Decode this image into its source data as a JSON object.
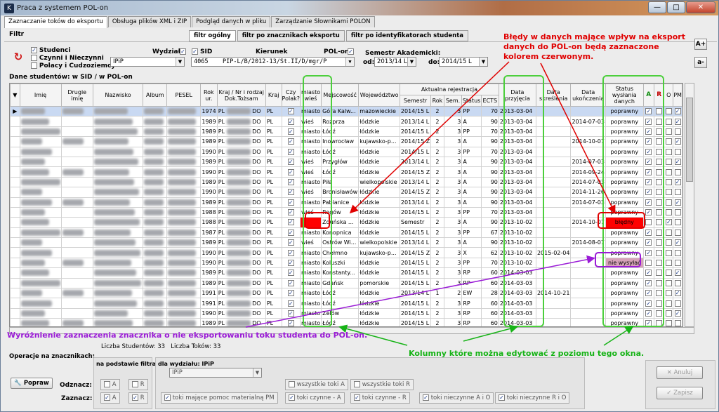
{
  "window": {
    "title": "Praca z systemem POL-on",
    "app_icon": "K"
  },
  "tabs": [
    "Zaznaczanie toków do eksportu",
    "Obsługa plików XML i ZIP",
    "Podgląd danych w pliku",
    "Zarządzanie Słownikami POLON"
  ],
  "filter": {
    "label": "Filtr",
    "subtabs": [
      "filtr ogólny",
      "filtr po znacznikach eksportu",
      "filtr po identyfikatorach studenta"
    ],
    "checks": {
      "studenci": "Studenci",
      "czynni": "Czynni i Nieczynni",
      "polacy": "Polacy i Cudzoziemcy"
    },
    "wydzial_label": "Wydział",
    "wydzial_value": "IPiP",
    "sid_label": "SID",
    "kierunek_label": "Kierunek",
    "polon_label": "POL-on",
    "sid_value": "4065",
    "kierunek_value": "PIP-L/B/2012-13/St.II/D/mgr/P",
    "semestr_label": "Semestr Akademicki:",
    "od_label": "od:",
    "od_value": "2013/14 L",
    "do_label": "do:",
    "do_value": "2014/15 L"
  },
  "grid": {
    "title": "Dane studentów: w SID / w POL-on",
    "headers": {
      "imie": "Imię",
      "drugie": "Drugie imię",
      "nazwisko": "Nazwisko",
      "album": "Album",
      "pesel": "PESEL",
      "rok": "Rok ur.",
      "kraj_nr": "Kraj / Nr i rodzaj Dok.Tożsam",
      "kraj": "Kraj",
      "czy_polak": "Czy Polak?",
      "miasto_wies": "miasto wieś",
      "miejscowosc": "Mejscowość",
      "wojewodztwo": "Województwo",
      "aktualna": "Aktualna rejestracja",
      "semestr": "Semestr",
      "rok_st": "Rok",
      "sem": "Sem.",
      "status": "Status",
      "ects": "ECTS",
      "data_przyjecia": "Data przyjęcia",
      "data_skreslenia": "Data skreślenia",
      "data_ukonczenia": "Data ukończenia",
      "status_wysylania": "Status wysłania danych",
      "a": "A",
      "r": "R",
      "o": "O",
      "pm": "PM"
    },
    "rows": [
      {
        "rok": "1974",
        "kraj": "PL",
        "dok": "DO",
        "k2": "PL",
        "mw": "miasto",
        "miej": "Góra Kalw...",
        "woj": "mazowieckie",
        "sem": "2014/15 L",
        "r": "2",
        "s": "3",
        "st": "PP",
        "ects": "70",
        "dp": "2013-03-04",
        "ds": "",
        "du": "",
        "sw": "poprawny",
        "a": true,
        "o": false,
        "pm": true,
        "sel": true
      },
      {
        "rok": "1989",
        "kraj": "PL",
        "dok": "DO",
        "k2": "PL",
        "mw": "wieś",
        "miej": "Rozprza",
        "woj": "łódzkie",
        "sem": "2013/14 L",
        "r": "2",
        "s": "3",
        "st": "A",
        "ects": "90",
        "dp": "2013-03-04",
        "ds": "",
        "du": "2014-07-03",
        "sw": "poprawny",
        "a": true,
        "o": false,
        "pm": true
      },
      {
        "rok": "1989",
        "kraj": "PL",
        "dok": "DO",
        "k2": "PL",
        "mw": "miasto",
        "miej": "Łódź",
        "woj": "łódzkie",
        "sem": "2014/15 L",
        "r": "2",
        "s": "3",
        "st": "PP",
        "ects": "70",
        "dp": "2013-03-04",
        "ds": "",
        "du": "",
        "sw": "poprawny",
        "a": true,
        "o": false,
        "pm": false
      },
      {
        "rok": "1989",
        "kraj": "PL",
        "dok": "DO",
        "k2": "PL",
        "mw": "miasto",
        "miej": "Inowrocław",
        "woj": "kujawsko-p...",
        "sem": "2014/15 Z",
        "r": "2",
        "s": "3",
        "st": "A",
        "ects": "90",
        "dp": "2013-03-04",
        "ds": "",
        "du": "2014-10-07",
        "sw": "poprawny",
        "a": true,
        "o": false,
        "pm": true
      },
      {
        "rok": "1990",
        "kraj": "PL",
        "dok": "DO",
        "k2": "PL",
        "mw": "miasto",
        "miej": "Łódź",
        "woj": "łódzkie",
        "sem": "2014/15 L",
        "r": "2",
        "s": "3",
        "st": "PP",
        "ects": "70",
        "dp": "2013-03-04",
        "ds": "",
        "du": "",
        "sw": "poprawny",
        "a": true,
        "o": false,
        "pm": false
      },
      {
        "rok": "1989",
        "kraj": "PL",
        "dok": "DO",
        "k2": "PL",
        "mw": "wieś",
        "miej": "Przygłów",
        "woj": "łódzkie",
        "sem": "2013/14 L",
        "r": "2",
        "s": "3",
        "st": "A",
        "ects": "90",
        "dp": "2013-03-04",
        "ds": "",
        "du": "2014-07-03",
        "sw": "poprawny",
        "a": true,
        "o": false,
        "pm": true
      },
      {
        "rok": "1990",
        "kraj": "PL",
        "dok": "DO",
        "k2": "PL",
        "mw": "wieś",
        "miej": "Łódź",
        "woj": "łódzkie",
        "sem": "2014/15 Z",
        "r": "2",
        "s": "3",
        "st": "A",
        "ects": "90",
        "dp": "2013-03-04",
        "ds": "",
        "du": "2014-09-24",
        "sw": "poprawny",
        "a": true,
        "o": false,
        "pm": false
      },
      {
        "rok": "1989",
        "kraj": "PL",
        "dok": "DO",
        "k2": "PL",
        "mw": "miasto",
        "miej": "Piła",
        "woj": "wielkopolskie",
        "sem": "2013/14 L",
        "r": "2",
        "s": "3",
        "st": "A",
        "ects": "90",
        "dp": "2013-03-04",
        "ds": "",
        "du": "2014-07-03",
        "sw": "poprawny",
        "a": true,
        "o": false,
        "pm": true
      },
      {
        "rok": "1990",
        "kraj": "PL",
        "dok": "DO",
        "k2": "PL",
        "mw": "wieś",
        "miej": "Bronisławów",
        "woj": "łódzkie",
        "sem": "2014/15 Z",
        "r": "2",
        "s": "3",
        "st": "A",
        "ects": "90",
        "dp": "2013-03-04",
        "ds": "",
        "du": "2014-11-26",
        "sw": "poprawny",
        "a": true,
        "o": false,
        "pm": false
      },
      {
        "rok": "1989",
        "kraj": "PL",
        "dok": "DO",
        "k2": "PL",
        "mw": "miasto",
        "miej": "Pabianice",
        "woj": "łódzkie",
        "sem": "2013/14 L",
        "r": "2",
        "s": "3",
        "st": "A",
        "ects": "90",
        "dp": "2013-03-04",
        "ds": "",
        "du": "2014-07-03",
        "sw": "poprawny",
        "a": true,
        "o": false,
        "pm": true
      },
      {
        "rok": "1988",
        "kraj": "PL",
        "dok": "DO",
        "k2": "PL",
        "mw": "wieś",
        "miej": "Rogów",
        "woj": "łódzkie",
        "sem": "2014/15 L",
        "r": "2",
        "s": "3",
        "st": "PP",
        "ects": "70",
        "dp": "2013-03-04",
        "ds": "",
        "du": "",
        "sw": "poprawny",
        "a": true,
        "o": false,
        "pm": false
      },
      {
        "rok": "1988",
        "kraj": "PL",
        "dok": "DO",
        "k2": "PL",
        "mw": "",
        "miej": "Zduńska ...",
        "woj": "łódzkie",
        "sem": "Semestr",
        "r": "2",
        "s": "3",
        "st": "A",
        "ects": "90",
        "dp": "2013-10-02",
        "ds": "",
        "du": "2014-10-07",
        "sw": "błędny",
        "a": false,
        "o": true,
        "pm": false,
        "err": true
      },
      {
        "rok": "1987",
        "kraj": "PL",
        "dok": "DO",
        "k2": "PL",
        "mw": "miasto",
        "miej": "Konopnica",
        "woj": "łódzkie",
        "sem": "2014/15 L",
        "r": "2",
        "s": "3",
        "st": "PP",
        "ects": "67",
        "dp": "2013-10-02",
        "ds": "",
        "du": "",
        "sw": "poprawny",
        "a": true,
        "o": false,
        "pm": false
      },
      {
        "rok": "1989",
        "kraj": "PL",
        "dok": "DO",
        "k2": "PL",
        "mw": "wieś",
        "miej": "Ostrów Wi...",
        "woj": "wielkopolskie",
        "sem": "2013/14 L",
        "r": "2",
        "s": "3",
        "st": "A",
        "ects": "90",
        "dp": "2013-10-02",
        "ds": "",
        "du": "2014-08-07",
        "sw": "poprawny",
        "a": true,
        "o": false,
        "pm": true
      },
      {
        "rok": "1990",
        "kraj": "PL",
        "dok": "DO",
        "k2": "PL",
        "mw": "miasto",
        "miej": "Chełmno",
        "woj": "kujawsko-p...",
        "sem": "2014/15 Z",
        "r": "2",
        "s": "3",
        "st": "X",
        "ects": "62",
        "dp": "2013-10-02",
        "ds": "2015-02-04",
        "du": "",
        "sw": "poprawny",
        "a": true,
        "o": false,
        "pm": false
      },
      {
        "rok": "1990",
        "kraj": "PL",
        "dok": "DO",
        "k2": "PL",
        "mw": "miasto",
        "miej": "Koluszki",
        "woj": "łódzkie",
        "sem": "2014/15 L",
        "r": "2",
        "s": "3",
        "st": "PP",
        "ects": "70",
        "dp": "2013-10-02",
        "ds": "",
        "du": "",
        "sw": "nie wysyłać",
        "a": false,
        "o": false,
        "pm": false,
        "nw": true
      },
      {
        "rok": "1989",
        "kraj": "PL",
        "dok": "DO",
        "k2": "PL",
        "mw": "miasto",
        "miej": "Konstanty...",
        "woj": "łódzkie",
        "sem": "2014/15 L",
        "r": "2",
        "s": "3",
        "st": "RP",
        "ects": "60",
        "dp": "2014-03-03",
        "ds": "",
        "du": "",
        "sw": "poprawny",
        "a": true,
        "o": false,
        "pm": true
      },
      {
        "rok": "1989",
        "kraj": "PL",
        "dok": "DO",
        "k2": "PL",
        "mw": "miasto",
        "miej": "Gdańsk",
        "woj": "pomorskie",
        "sem": "2014/15 L",
        "r": "2",
        "s": "3",
        "st": "RP",
        "ects": "60",
        "dp": "2014-03-03",
        "ds": "",
        "du": "",
        "sw": "poprawny",
        "a": true,
        "o": false,
        "pm": false
      },
      {
        "rok": "1991",
        "kraj": "PL",
        "dok": "DO",
        "k2": "PL",
        "mw": "miasto",
        "miej": "Łódź",
        "woj": "łódzkie",
        "sem": "2013/14 L",
        "r": "1",
        "s": "2",
        "st": "EW",
        "ects": "28",
        "dp": "2014-03-03",
        "ds": "2014-10-21",
        "du": "",
        "sw": "poprawny",
        "a": true,
        "o": false,
        "pm": true
      },
      {
        "rok": "1991",
        "kraj": "PL",
        "dok": "DO",
        "k2": "PL",
        "mw": "miasto",
        "miej": "Łódź",
        "woj": "łódzkie",
        "sem": "2014/15 L",
        "r": "2",
        "s": "3",
        "st": "RP",
        "ects": "60",
        "dp": "2014-03-03",
        "ds": "",
        "du": "",
        "sw": "poprawny",
        "a": true,
        "o": false,
        "pm": false
      },
      {
        "rok": "1990",
        "kraj": "PL",
        "dok": "DO",
        "k2": "PL",
        "mw": "miasto",
        "miej": "Zelów",
        "woj": "łódzkie",
        "sem": "2014/15 L",
        "r": "2",
        "s": "3",
        "st": "RP",
        "ects": "60",
        "dp": "2014-03-03",
        "ds": "",
        "du": "",
        "sw": "poprawny",
        "a": true,
        "o": false,
        "pm": true
      },
      {
        "rok": "1989",
        "kraj": "PL",
        "dok": "DO",
        "k2": "PL",
        "mw": "miasto",
        "miej": "Łódź",
        "woj": "łódzkie",
        "sem": "2014/15 L",
        "r": "2",
        "s": "3",
        "st": "RP",
        "ects": "60",
        "dp": "2014-03-03",
        "ds": "",
        "du": "",
        "sw": "poprawny",
        "a": true,
        "o": false,
        "pm": false
      }
    ]
  },
  "counts": {
    "students_label": "Liczba Studentów:",
    "students": "33",
    "tokow_label": "Liczba Toków:",
    "tokow": "33"
  },
  "ops": {
    "title": "Operacje na znacznikach:",
    "filter_label": "na podstawie filtra",
    "wydzial_label": "dla wydziału: IPiP",
    "wydzial_value": "IPiP",
    "popraw": "Popraw",
    "odznacz": "Odznacz:",
    "zaznacz": "Zaznacz:",
    "a": "A",
    "r": "R",
    "wszystkie_a": "wszystkie toki A",
    "wszystkie_r": "wszystkie toki R",
    "pm": "toki mające pomoc materialną PM",
    "czynne_a": "toki czynne - A",
    "czynne_r": "toki czynne - R",
    "nieczynne_a": "toki nieczynne A i O",
    "nieczynne_r": "toki nieczynne R i O",
    "anuluj": "Anuluj",
    "zapisz": "Zapisz"
  },
  "side_buttons": {
    "plus": "A+",
    "minus": "a-"
  },
  "annotations": {
    "errors": "Błędy w  danych mające wpływ na eksport danych do POL-on będą zaznaczone kolorem czerwonym.",
    "noexport": "Wyróżnienie zaznaczenia znacznika o nie eksportowaniu toku studenta do POL-on.",
    "editable": "Kolumny które można edytować z poziomu tego okna."
  },
  "colors": {
    "error": "#ff0000",
    "annotation_red": "#e00000",
    "annotation_purple": "#9a1bd6",
    "annotation_green": "#17b317"
  }
}
